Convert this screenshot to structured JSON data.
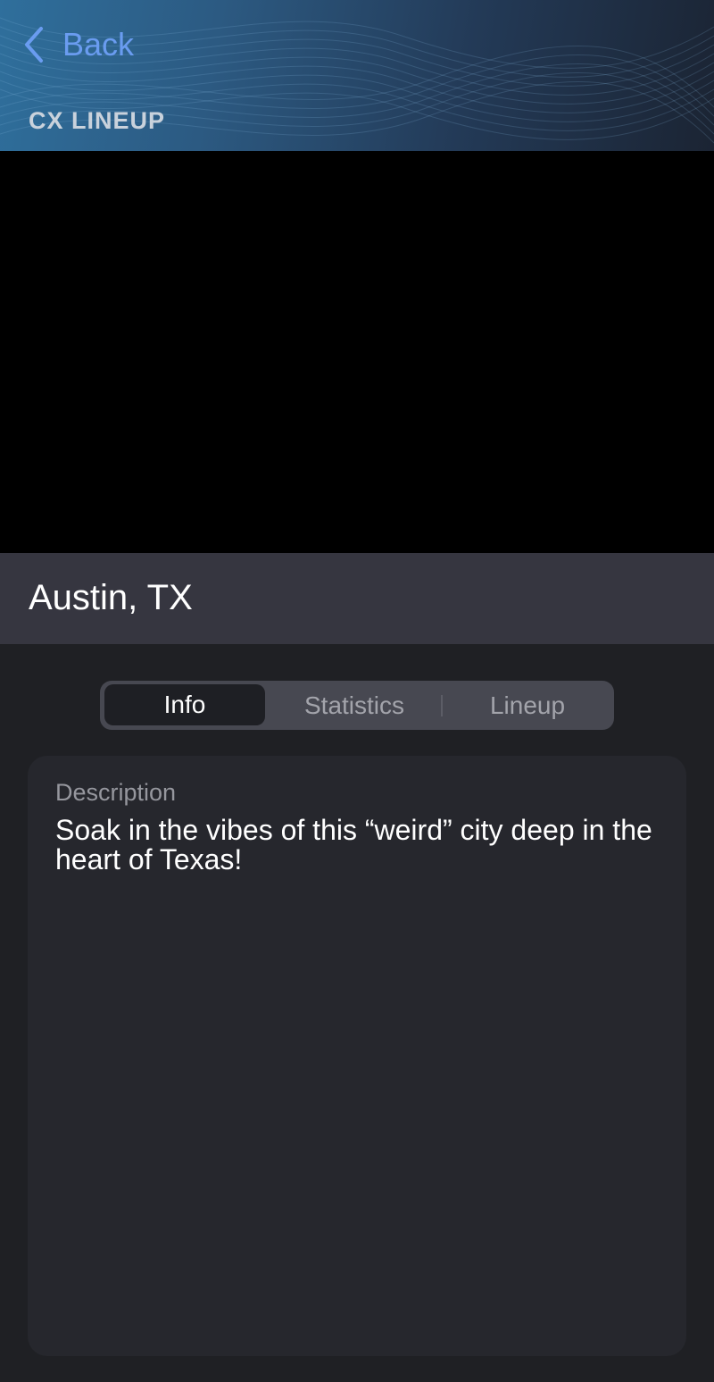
{
  "header": {
    "back_label": "Back",
    "title": "CX LINEUP",
    "accent_color": "#6a9cf0"
  },
  "location": {
    "title": "Austin, TX"
  },
  "tabs": [
    {
      "label": "Info",
      "active": true
    },
    {
      "label": "Statistics",
      "active": false
    },
    {
      "label": "Lineup",
      "active": false
    }
  ],
  "info_card": {
    "label": "Description",
    "text": "Soak in the vibes of this “weird” city deep in the heart of Texas!"
  },
  "icons": {
    "back": "chevron-left-icon"
  }
}
